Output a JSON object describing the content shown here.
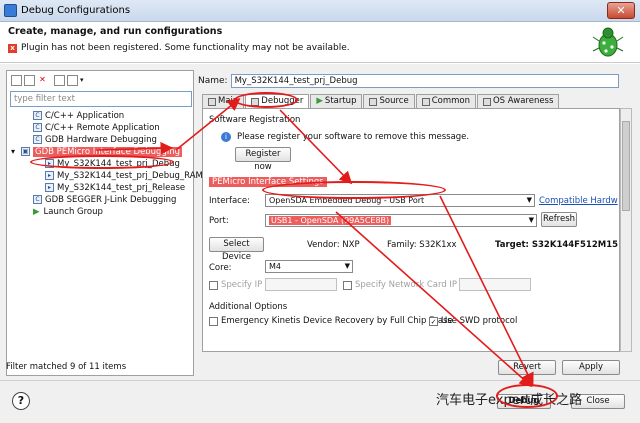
{
  "window": {
    "title": "Debug Configurations",
    "close_label": "✕"
  },
  "header": {
    "title": "Create, manage, and run configurations",
    "warning": "Plugin has not been registered. Some functionality may not be available."
  },
  "left": {
    "filter_placeholder": "type filter text",
    "tree": [
      {
        "label": "C/C++ Application",
        "indent": 1
      },
      {
        "label": "C/C++ Remote Application",
        "indent": 1
      },
      {
        "label": "GDB Hardware Debugging",
        "indent": 1
      },
      {
        "label": "GDB PEMicro Interface Debugging",
        "indent": 0,
        "expanded": "▾"
      },
      {
        "label": "My_S32K144_test_prj_Debug",
        "indent": 2
      },
      {
        "label": "My_S32K144_test_prj_Debug_RAM",
        "indent": 2
      },
      {
        "label": "My_S32K144_test_prj_Release",
        "indent": 2
      },
      {
        "label": "GDB SEGGER J-Link Debugging",
        "indent": 1
      },
      {
        "label": "Launch Group",
        "indent": 1
      }
    ],
    "status": "Filter matched 9 of 11 items"
  },
  "right": {
    "name_label": "Name:",
    "name_value": "My_S32K144_test_prj_Debug",
    "tabs": [
      "Main",
      "Debugger",
      "Startup",
      "Source",
      "Common",
      "OS Awareness"
    ],
    "software_registration": "Software Registration",
    "register_message": "Please register your software to remove this message.",
    "register_button": "Register now",
    "pemicro_settings": "PEMicro Interface Settings",
    "interface_label": "Interface:",
    "interface_value": "OpenSDA Embedded Debug - USB Port",
    "compat_link": "Compatible Hardw",
    "port_label": "Port:",
    "port_value": "USB1 - OpenSDA (99A5CE8B)",
    "refresh_button": "Refresh",
    "select_device_button": "Select Device",
    "vendor": "Vendor: NXP",
    "family": "Family: S32K1xx",
    "target": "Target: S32K144F512M15",
    "core_label": "Core:",
    "core_value": "M4",
    "specify_ip": "Specify IP",
    "specify_nic": "Specify Network Card IP",
    "additional_options": "Additional Options",
    "emergency_option": "Emergency Kinetis Device Recovery by Full Chip Erase",
    "swd_option": "Use SWD protocol",
    "revert_button": "Revert",
    "apply_button": "Apply"
  },
  "footer": {
    "help": "?",
    "debug_button": "Debug",
    "close_button": "Close",
    "watermark": "汽车电子expert成长之路"
  },
  "colors": {
    "annotation": "#e21b1b",
    "link": "#1a4fb8"
  }
}
